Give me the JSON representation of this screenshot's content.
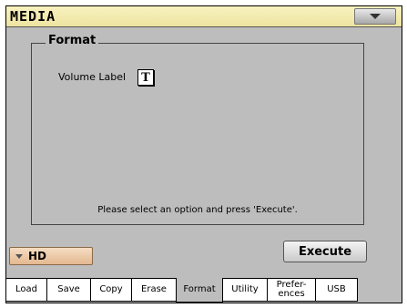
{
  "window": {
    "title": "MEDIA"
  },
  "page": {
    "group_label": "Format",
    "volume_label_text": "Volume Label",
    "text_button_label": "T",
    "status_message": "Please select an option and press 'Execute'."
  },
  "controls": {
    "device_selected": "HD",
    "execute_label": "Execute"
  },
  "tabs": [
    {
      "label": "Load"
    },
    {
      "label": "Save"
    },
    {
      "label": "Copy"
    },
    {
      "label": "Erase"
    },
    {
      "label": "Format",
      "active": true
    },
    {
      "label": "Utility"
    },
    {
      "label": "Prefer-\nences"
    },
    {
      "label": "USB"
    }
  ],
  "icons": {
    "menu": "triangle-down-icon",
    "device_dropdown": "triangle-down-icon"
  }
}
